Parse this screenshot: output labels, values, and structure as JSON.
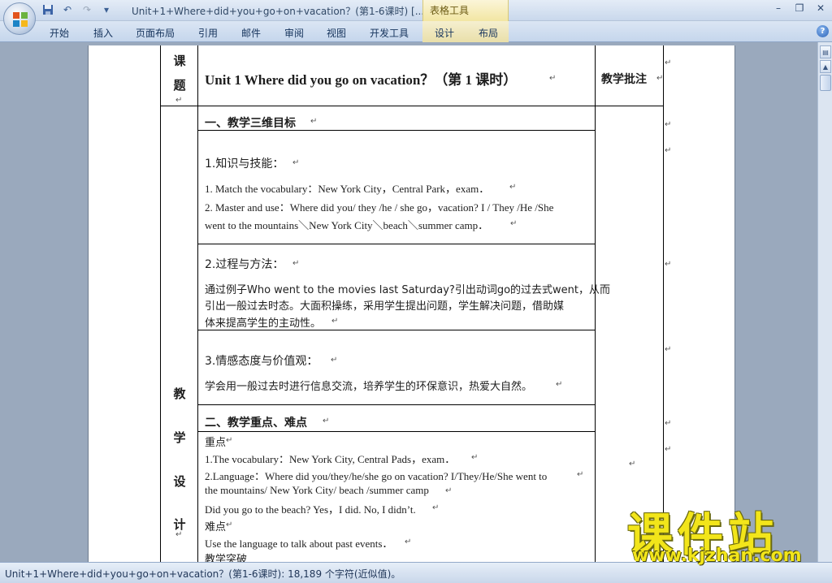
{
  "window": {
    "doc_title": "Unit+1+Where+did+you+go+on+vacation？(第1-6课时) [...",
    "context_tab": "表格工具"
  },
  "ribbon": {
    "tabs": [
      "开始",
      "插入",
      "页面布局",
      "引用",
      "邮件",
      "审阅",
      "视图",
      "开发工具",
      "设计",
      "布局"
    ]
  },
  "icons": {
    "office_button": "office-logo",
    "save": "save-icon",
    "undo": "undo-icon",
    "redo": "redo-icon",
    "customize": "qat-dropdown-icon",
    "help": "help-icon"
  },
  "document": {
    "subject_label": [
      "课",
      "题"
    ],
    "unit_title": "Unit 1 Where did you go on vacation？（第 1 课时）",
    "comment_header": "教学批注",
    "section1_title": "一、教学三维目标",
    "knowledge_title": "1.知识与技能：",
    "knowledge_1": "1. Match the vocabulary：New York City，Central Park，exam．",
    "knowledge_2a": "2. Master and use：Where did you/ they /he / she go，vacation? I / They /He /She",
    "knowledge_2b": "went to the mountains＼New York City＼beach＼summer camp．",
    "process_title": "2.过程与方法：",
    "process_1": "通过例子Who went to the movies last Saturday?引出动词go的过去式went，从而",
    "process_2": "引出一般过去时态。大面积操练，采用学生提出问题，学生解决问题，借助媒",
    "process_3": "体来提高学生的主动性。",
    "attitude_title": "3.情感态度与价值观：",
    "attitude_1": "学会用一般过去时进行信息交流，培养学生的环保意识，热爱大自然。",
    "section2_title": "二、教学重点、难点",
    "key_label": "重点",
    "key_1": "1.The vocabulary：New York City, Central Pads，exam．",
    "key_2a": "2.Language：Where did you/they/he/she go on vacation? I/They/He/She went to",
    "key_2b": "the mountains/ New York City/ beach /summer camp",
    "key_3": "Did you go to the beach? Yes，I did. No, I didn’t.",
    "difficulty_label": "难点",
    "difficulty_1": "Use the language to talk about past events．",
    "breakthrough_label": "教学突破",
    "design_label": [
      "教",
      "学",
      "设",
      "计"
    ]
  },
  "status": {
    "text": "Unit+1+Where+did+you+go+on+vacation？(第1-6课时): 18,189 个字符(近似值)。"
  },
  "watermark": {
    "cn": "课件站",
    "url": "www.kjzhan.com"
  }
}
